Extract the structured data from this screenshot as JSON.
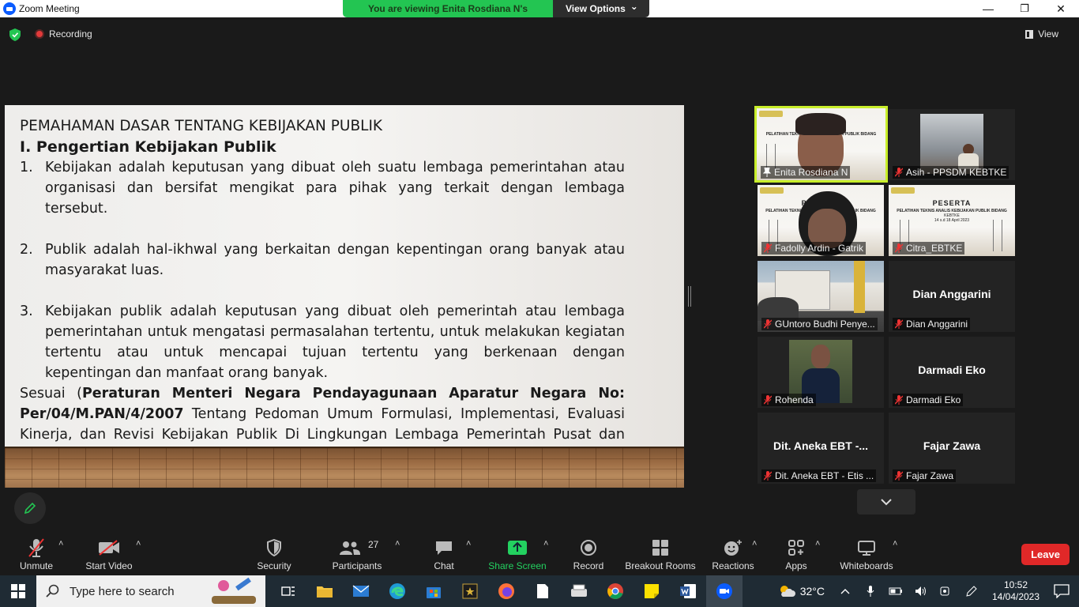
{
  "window": {
    "title": "Zoom Meeting",
    "minimize": "—",
    "maximize": "❐",
    "close": "✕"
  },
  "banner": {
    "viewing_text": "You are viewing Enita Rosdiana N's screen",
    "view_options": "View Options",
    "view_options_caret": "⌄"
  },
  "top": {
    "recording": "Recording",
    "view": "View"
  },
  "slide": {
    "title": "PEMAHAMAN DASAR TENTANG KEBIJAKAN PUBLIK",
    "heading": "I. Pengertian Kebijakan Publik",
    "items": [
      {
        "num": "1.",
        "text": "Kebijakan adalah keputusan yang dibuat oleh suatu lembaga pemerintahan atau organisasi dan bersifat mengikat para pihak yang terkait dengan lembaga tersebut."
      },
      {
        "num": "2.",
        "text": "Publik adalah hal-ikhwal yang berkaitan dengan kepentingan orang banyak atau masyarakat luas."
      },
      {
        "num": "3.",
        "text": "Kebijakan publik adalah keputusan yang dibuat oleh pemerintah atau lembaga pemerintahan untuk mengatasi permasalahan tertentu, untuk melakukan kegiatan tertentu atau untuk mencapai tujuan tertentu yang berkenaan dengan kepentingan dan manfaat orang banyak."
      }
    ],
    "ref_prefix": "Sesuai (",
    "ref_bold": "Peraturan Menteri Negara Pendayagunaan Aparatur Negara No: Per/04/M.PAN/4/2007",
    "ref_rest": " Tentang Pedoman Umum Formulasi, Implementasi, Evaluasi Kinerja, dan Revisi Kebijakan Publik Di Lingkungan Lembaga Pemerintah Pusat dan Daerah )."
  },
  "gallery": [
    {
      "name": "Enita Rosdiana N",
      "pinned": true,
      "muted": false,
      "slide_title": "PESERTA",
      "slide_sub": "PELATIHAN TEKNIS ANALIS KEBIJAKAN PUBLIK BIDANG"
    },
    {
      "name": "Asih - PPSDM KEBTKE",
      "muted": true
    },
    {
      "name": "Fadolly Ardin - Gatrik",
      "muted": true,
      "slide_title": "PESERTA",
      "slide_sub": "PELATIHAN TEKNIS ANALIS KEBIJAKAN PUBLIK BIDANG"
    },
    {
      "name": "Citra_EBTKE",
      "muted": true,
      "slide_title": "PESERTA",
      "slide_sub": "PELATIHAN TEKNIS ANALIS KEBIJAKAN PUBLIK BIDANG",
      "slide_sub2": "KEBTKE",
      "slide_date": "14 s.d 18 April 2023"
    },
    {
      "name": "GUntoro Budhi Penye...",
      "muted": true
    },
    {
      "name": "Dian Anggarini",
      "display": "Dian Anggarini",
      "muted": true
    },
    {
      "name": "Rohenda",
      "muted": true
    },
    {
      "name": "Darmadi Eko",
      "display": "Darmadi Eko",
      "muted": true
    },
    {
      "name": "Dit. Aneka EBT - Etis ...",
      "display": "Dit. Aneka EBT -...",
      "muted": true
    },
    {
      "name": "Fajar Zawa",
      "display": "Fajar Zawa",
      "muted": true
    }
  ],
  "toolbar": {
    "unmute": "Unmute",
    "start_video": "Start Video",
    "security": "Security",
    "participants": "Participants",
    "participants_count": "27",
    "chat": "Chat",
    "share_screen": "Share Screen",
    "record": "Record",
    "breakout": "Breakout Rooms",
    "reactions": "Reactions",
    "apps": "Apps",
    "whiteboards": "Whiteboards",
    "leave": "Leave",
    "caret": "˄"
  },
  "taskbar": {
    "search_placeholder": "Type here to search",
    "temperature": "32°C",
    "time": "10:52",
    "date": "14/04/2023"
  },
  "colors": {
    "share_green": "#23d160",
    "banner_green": "#23c552",
    "leave_red": "#e02828",
    "active_outline": "#c8ee2a"
  }
}
